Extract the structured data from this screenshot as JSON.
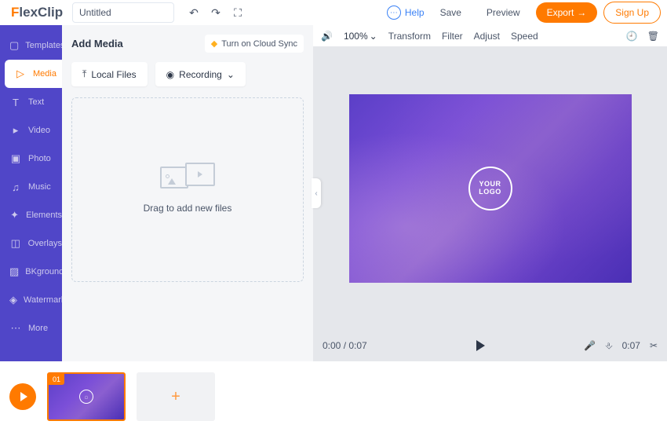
{
  "brand": {
    "f": "F",
    "rest": "lex",
    "c": "Clip"
  },
  "project_title": "Untitled",
  "topbar": {
    "help": "Help",
    "save": "Save",
    "preview": "Preview",
    "export": "Export",
    "signup": "Sign Up"
  },
  "sidebar": {
    "items": [
      {
        "label": "Templates"
      },
      {
        "label": "Media"
      },
      {
        "label": "Text"
      },
      {
        "label": "Video"
      },
      {
        "label": "Photo"
      },
      {
        "label": "Music"
      },
      {
        "label": "Elements"
      },
      {
        "label": "Overlays"
      },
      {
        "label": "BKground"
      },
      {
        "label": "Watermark"
      },
      {
        "label": "More"
      }
    ]
  },
  "media_panel": {
    "title": "Add Media",
    "cloud_sync": "Turn on Cloud Sync",
    "local_files": "Local Files",
    "recording": "Recording",
    "drop_text": "Drag to add new files"
  },
  "preview_toolbar": {
    "zoom": "100%",
    "transform": "Transform",
    "filter": "Filter",
    "adjust": "Adjust",
    "speed": "Speed"
  },
  "canvas_logo": {
    "l1": "YOUR",
    "l2": "LOGO"
  },
  "player": {
    "time": "0:00 / 0:07",
    "duration": "0:07"
  },
  "timeline": {
    "clip_num": "01",
    "add": "+"
  }
}
